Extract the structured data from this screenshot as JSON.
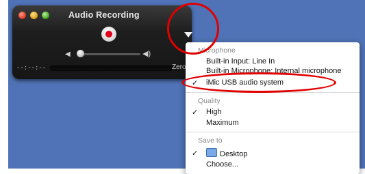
{
  "window": {
    "title": "Audio Recording",
    "time_display": "--:--:--",
    "size_text": "Zero",
    "volume_level": 0.05
  },
  "menu": {
    "microphone_header": "Microphone",
    "microphone_items": [
      {
        "label": "Built-in Input: Line In",
        "checked": false
      },
      {
        "label": "Built-in Microphone: Internal microphone",
        "checked": false
      },
      {
        "label": "iMic USB audio system",
        "checked": true
      }
    ],
    "quality_header": "Quality",
    "quality_items": [
      {
        "label": "High",
        "checked": true
      },
      {
        "label": "Maximum",
        "checked": false
      }
    ],
    "save_header": "Save to",
    "save_items": [
      {
        "label": "Desktop",
        "checked": true,
        "icon": "folder-icon"
      },
      {
        "label": "Choose...",
        "checked": false
      }
    ]
  },
  "colors": {
    "desktop": "#4f73b6",
    "annotation": "#e00000",
    "record": "#e2001a"
  }
}
